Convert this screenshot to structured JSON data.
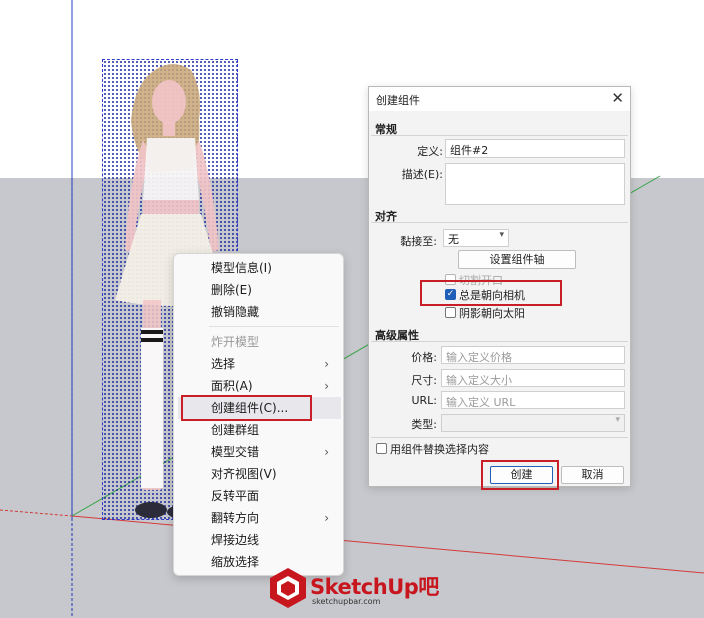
{
  "context_menu": {
    "items": [
      {
        "label": "模型信息(I)",
        "enabled": true,
        "submenu": false
      },
      {
        "label": "删除(E)",
        "enabled": true,
        "submenu": false
      },
      {
        "label": "撤销隐藏",
        "enabled": true,
        "submenu": false
      },
      {
        "label": "炸开模型",
        "enabled": false,
        "submenu": false
      },
      {
        "label": "选择",
        "enabled": true,
        "submenu": true
      },
      {
        "label": "面积(A)",
        "enabled": true,
        "submenu": true
      },
      {
        "label": "创建组件(C)...",
        "enabled": true,
        "submenu": false,
        "highlighted": true
      },
      {
        "label": "创建群组",
        "enabled": true,
        "submenu": false
      },
      {
        "label": "模型交错",
        "enabled": true,
        "submenu": true
      },
      {
        "label": "对齐视图(V)",
        "enabled": true,
        "submenu": false
      },
      {
        "label": "反转平面",
        "enabled": true,
        "submenu": false
      },
      {
        "label": "翻转方向",
        "enabled": true,
        "submenu": true
      },
      {
        "label": "焊接边线",
        "enabled": true,
        "submenu": false
      },
      {
        "label": "缩放选择",
        "enabled": true,
        "submenu": false
      }
    ],
    "submenu_arrow": "›"
  },
  "dialog": {
    "title": "创建组件",
    "close_icon": "✕",
    "general": {
      "section": "常规",
      "definition_label": "定义:",
      "definition_value": "组件#2",
      "description_label": "描述(E):",
      "description_value": ""
    },
    "alignment": {
      "section": "对齐",
      "glue_label": "黏接至:",
      "glue_value": "无",
      "set_axes_button": "设置组件轴",
      "cut_opening_label": "切割开口",
      "cut_opening_checked": false,
      "always_face_camera_label": "总是朝向相机",
      "always_face_camera_checked": true,
      "shadows_face_sun_label": "阴影朝向太阳",
      "shadows_face_sun_checked": false
    },
    "advanced": {
      "section": "高级属性",
      "price_label": "价格:",
      "price_placeholder": "输入定义价格",
      "size_label": "尺寸:",
      "size_placeholder": "输入定义大小",
      "url_label": "URL:",
      "url_placeholder": "输入定义 URL",
      "type_label": "类型:",
      "type_value": ""
    },
    "replace_selection_label": "用组件替换选择内容",
    "replace_selection_checked": false,
    "create_button": "创建",
    "cancel_button": "取消"
  },
  "watermark": {
    "name": "SketchUp吧",
    "url": "sketchupbar.com"
  },
  "colors": {
    "highlight_box": "#c81e28",
    "selection": "#2c39c9",
    "ground": "#c7c8cd",
    "checkbox_checked": "#1f5fb8"
  }
}
